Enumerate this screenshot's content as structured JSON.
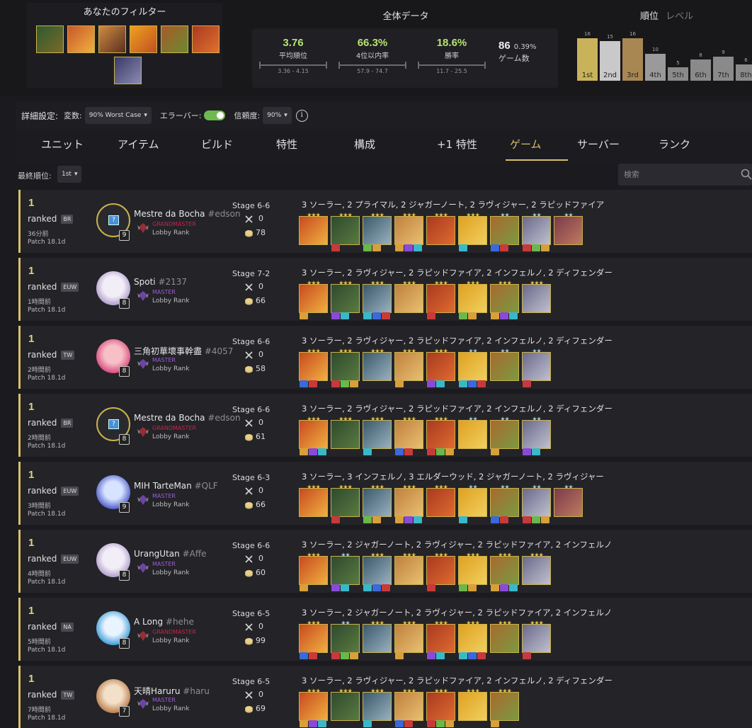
{
  "filter": {
    "title": "あなたのフィルター",
    "icons": [
      {
        "name": "champion-filter-icon",
        "colors": [
          "#2e5a2e",
          "#7a6a2a"
        ]
      },
      {
        "name": "champion-filter-icon",
        "colors": [
          "#c8582a",
          "#f0b040"
        ]
      },
      {
        "name": "champion-filter-icon",
        "colors": [
          "#d08a40",
          "#5a3020"
        ]
      },
      {
        "name": "champion-filter-icon",
        "colors": [
          "#f0a020",
          "#c05020"
        ]
      },
      {
        "name": "champion-filter-icon",
        "colors": [
          "#a85a2a",
          "#6a8a30"
        ]
      },
      {
        "name": "champion-filter-icon",
        "colors": [
          "#a83a20",
          "#e07030"
        ]
      },
      {
        "name": "champion-filter-icon",
        "colors": [
          "#3a3a6a",
          "#8a8ab0"
        ]
      }
    ]
  },
  "overall": {
    "title": "全体データ",
    "stats": [
      {
        "value": "3.76",
        "label": "平均順位",
        "range": "3.36 - 4.15"
      },
      {
        "value": "66.3%",
        "label": "4位以内率",
        "range": "57.9 - 74.7"
      },
      {
        "value": "18.6%",
        "label": "勝率",
        "range": "11.7 - 25.5"
      }
    ],
    "games": {
      "count": "86",
      "pct": "0.39%",
      "label": "ゲーム数"
    }
  },
  "rank_panel": {
    "tab_active": "順位",
    "tab_inactive": "レベル",
    "bars": [
      {
        "place": "1st",
        "count": 16,
        "color": "#c9b35a"
      },
      {
        "place": "2nd",
        "count": 15,
        "color": "#c9c9c9"
      },
      {
        "place": "3rd",
        "count": 16,
        "color": "#a88752"
      },
      {
        "place": "4th",
        "count": 10,
        "color": "#9a9a9a"
      },
      {
        "place": "5th",
        "count": 5,
        "color": "#8a8a8a"
      },
      {
        "place": "6th",
        "count": 8,
        "color": "#8a8a8a"
      },
      {
        "place": "7th",
        "count": 9,
        "color": "#8a8a8a"
      },
      {
        "place": "8th",
        "count": 6,
        "color": "#8a8a8a"
      }
    ]
  },
  "settings": {
    "label": "詳細設定:",
    "var_label": "変数:",
    "var_value": "90% Worst Case",
    "errorbar_label": "エラーバー:",
    "conf_label": "信頼度:",
    "conf_value": "90%",
    "info": "i"
  },
  "tabs": [
    "ユニット",
    "アイテム",
    "ビルド",
    "特性",
    "構成",
    "+1 特性",
    "ゲーム",
    "サーバー",
    "ランク"
  ],
  "subfilter": {
    "label": "最終順位:",
    "value": "1st",
    "search_placeholder": "検索"
  },
  "rows": [
    {
      "place": "1",
      "queue": "ranked",
      "region": "BR",
      "time": "36分前",
      "patch": "Patch 18.1d",
      "avatar": "plain",
      "level": "9",
      "name": "Mestre da Bocha",
      "tag": "#edson",
      "tier": "GRANDMASTER",
      "lobby": "Lobby Rank",
      "stage": "Stage 6-6",
      "kills": "0",
      "gold": "78",
      "traits": "3 ソーラー, 2 プライマル, 2 ジャガーノート, 2 ラヴィジャー, 2 ラピッドファイア",
      "units": [
        {
          "stars": 3
        },
        {
          "stars": 3
        },
        {
          "stars": 3
        },
        {
          "stars": 3
        },
        {
          "stars": 3
        },
        {
          "stars": 3
        },
        {
          "stars": 2
        },
        {
          "stars": 2
        },
        {
          "stars": 2
        }
      ]
    },
    {
      "place": "1",
      "queue": "ranked",
      "region": "EUW",
      "time": "1時間前",
      "patch": "Patch 18.1d",
      "avatar": "poro",
      "level": "8",
      "name": "Spoti",
      "tag": "#2137",
      "tier": "MASTER",
      "lobby": "Lobby Rank",
      "stage": "Stage 7-2",
      "kills": "0",
      "gold": "66",
      "traits": "3 ソーラー, 2 ラヴィジャー, 2 ラピッドファイア, 2 インフェルノ, 2 ディフェンダー",
      "units": [
        {
          "stars": 3
        },
        {
          "stars": 3
        },
        {
          "stars": 3
        },
        {
          "stars": 3
        },
        {
          "stars": 3
        },
        {
          "stars": 3
        },
        {
          "stars": 3
        },
        {
          "stars": 3
        }
      ]
    },
    {
      "place": "1",
      "queue": "ranked",
      "region": "TW",
      "time": "2時間前",
      "patch": "Patch 18.1d",
      "avatar": "pink",
      "level": "8",
      "name": "三角初華壞事幹盡",
      "tag": "#4057",
      "tier": "MASTER",
      "lobby": "Lobby Rank",
      "stage": "Stage 6-6",
      "kills": "0",
      "gold": "58",
      "traits": "3 ソーラー, 2 ラヴィジャー, 2 ラピッドファイア, 2 インフェルノ, 2 ディフェンダー",
      "units": [
        {
          "stars": 3
        },
        {
          "stars": 3
        },
        {
          "stars": 3
        },
        {
          "stars": 3
        },
        {
          "stars": 3
        },
        {
          "stars": 2
        },
        {
          "stars": 2
        },
        {
          "stars": 2
        }
      ]
    },
    {
      "place": "1",
      "queue": "ranked",
      "region": "BR",
      "time": "2時間前",
      "patch": "Patch 18.1d",
      "avatar": "plain",
      "level": "8",
      "name": "Mestre da Bocha",
      "tag": "#edson",
      "tier": "GRANDMASTER",
      "lobby": "Lobby Rank",
      "stage": "Stage 6-6",
      "kills": "0",
      "gold": "61",
      "traits": "3 ソーラー, 2 ラヴィジャー, 2 ラピッドファイア, 2 インフェルノ, 2 ディフェンダー",
      "units": [
        {
          "stars": 3
        },
        {
          "stars": 3
        },
        {
          "stars": 3
        },
        {
          "stars": 3
        },
        {
          "stars": 3
        },
        {
          "stars": 2
        },
        {
          "stars": 2
        },
        {
          "stars": 2
        }
      ]
    },
    {
      "place": "1",
      "queue": "ranked",
      "region": "EUW",
      "time": "3時間前",
      "patch": "Patch 18.1d",
      "avatar": "blue",
      "level": "9",
      "name": "MIH TarteMan",
      "tag": "#QLF",
      "tier": "MASTER",
      "lobby": "Lobby Rank",
      "stage": "Stage 6-3",
      "kills": "0",
      "gold": "66",
      "traits": "3 ソーラー, 3 インフェルノ, 3 エルダーウッド, 2 ジャガーノート, 2 ラヴィジャー",
      "units": [
        {
          "stars": 3
        },
        {
          "stars": 3
        },
        {
          "stars": 3
        },
        {
          "stars": 3
        },
        {
          "stars": 3
        },
        {
          "stars": 2
        },
        {
          "stars": 2
        },
        {
          "stars": 2
        },
        {
          "stars": 2
        }
      ]
    },
    {
      "place": "1",
      "queue": "ranked",
      "region": "EUW",
      "time": "4時間前",
      "patch": "Patch 18.1d",
      "avatar": "poro",
      "level": "8",
      "name": "UrangUtan",
      "tag": "#Affe",
      "tier": "MASTER",
      "lobby": "Lobby Rank",
      "stage": "Stage 6-6",
      "kills": "0",
      "gold": "60",
      "traits": "3 ソーラー, 2 ジャガーノート, 2 ラヴィジャー, 2 ラピッドファイア, 2 インフェルノ",
      "units": [
        {
          "stars": 3
        },
        {
          "stars": 2
        },
        {
          "stars": 3
        },
        {
          "stars": 3
        },
        {
          "stars": 3
        },
        {
          "stars": 3
        },
        {
          "stars": 3
        },
        {
          "stars": 3
        }
      ]
    },
    {
      "place": "1",
      "queue": "ranked",
      "region": "NA",
      "time": "5時間前",
      "patch": "Patch 18.1d",
      "avatar": "cyan",
      "level": "8",
      "name": "A Long",
      "tag": "#hehe",
      "tier": "GRANDMASTER",
      "lobby": "Lobby Rank",
      "stage": "Stage 6-5",
      "kills": "0",
      "gold": "99",
      "traits": "3 ソーラー, 2 ジャガーノート, 2 ラヴィジャー, 2 ラピッドファイア, 2 インフェルノ",
      "units": [
        {
          "stars": 3
        },
        {
          "stars": 2
        },
        {
          "stars": 3
        },
        {
          "stars": 3
        },
        {
          "stars": 3
        },
        {
          "stars": 3
        },
        {
          "stars": 3
        },
        {
          "stars": 3
        }
      ]
    },
    {
      "place": "1",
      "queue": "ranked",
      "region": "TW",
      "time": "7時間前",
      "patch": "Patch 18.1d",
      "avatar": "tan",
      "level": "7",
      "name": "天晴Haruru",
      "tag": "#haru",
      "tier": "MASTER",
      "lobby": "Lobby Rank",
      "stage": "Stage 6-5",
      "kills": "0",
      "gold": "69",
      "traits": "3 ソーラー, 2 ラヴィジャー, 2 ラピッドファイア, 2 インフェルノ, 2 ディフェンダー",
      "units": [
        {
          "stars": 3
        },
        {
          "stars": 3
        },
        {
          "stars": 3
        },
        {
          "stars": 3
        },
        {
          "stars": 3
        },
        {
          "stars": 3
        },
        {
          "stars": 3
        }
      ]
    }
  ]
}
